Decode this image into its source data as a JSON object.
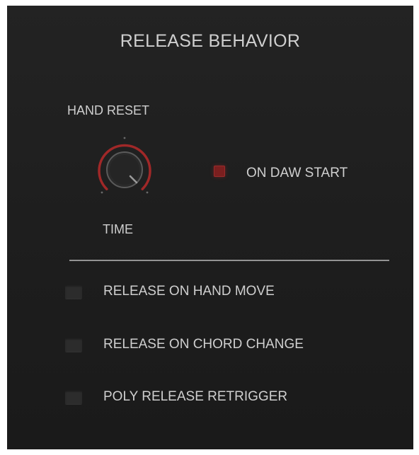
{
  "panel": {
    "title": "RELEASE BEHAVIOR",
    "hand_reset": {
      "label": "HAND RESET",
      "knob": {
        "label": "TIME",
        "icon": "knob-icon",
        "accent_color": "#a02828"
      },
      "on_daw_start": {
        "label": "ON DAW START",
        "checked": true,
        "color": "#7b1f1f"
      }
    },
    "options": [
      {
        "label": "RELEASE ON HAND MOVE",
        "checked": false
      },
      {
        "label": "RELEASE ON CHORD CHANGE",
        "checked": false
      },
      {
        "label": "POLY RELEASE RETRIGGER",
        "checked": false
      }
    ]
  }
}
